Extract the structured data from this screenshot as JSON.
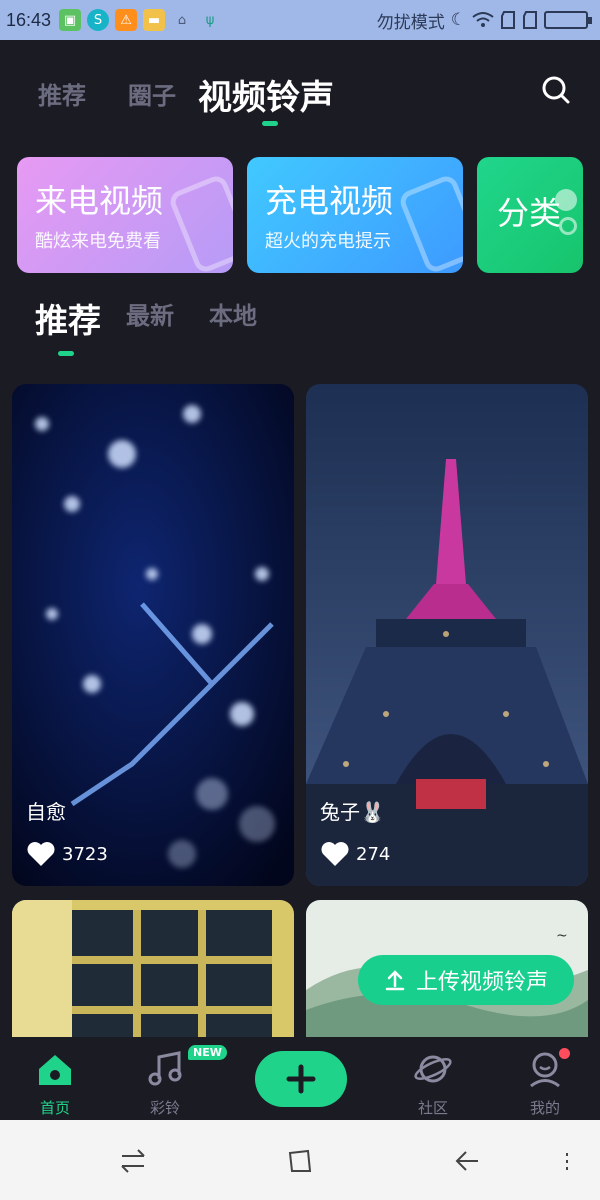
{
  "status_bar": {
    "time": "16:43",
    "dnd_label": "勿扰模式",
    "app_icons": [
      "bag-icon",
      "sogou-icon",
      "warning-icon",
      "folder-icon",
      "broom-icon",
      "usb-icon"
    ]
  },
  "top_tabs": [
    {
      "label": "推荐",
      "active": false
    },
    {
      "label": "圈子",
      "active": false
    },
    {
      "label": "视频铃声",
      "active": true
    }
  ],
  "feature_cards": [
    {
      "title": "来电视频",
      "subtitle": "酷炫来电免费看",
      "color": "#c39af5"
    },
    {
      "title": "充电视频",
      "subtitle": "超火的充电提示",
      "color": "#3fb6ff"
    },
    {
      "title": "分类",
      "subtitle": "",
      "color": "#1fcf7c"
    }
  ],
  "sub_tabs": [
    {
      "label": "推荐",
      "active": true
    },
    {
      "label": "最新",
      "active": false
    },
    {
      "label": "本地",
      "active": false
    }
  ],
  "videos": [
    {
      "title": "自愈",
      "likes": "3723"
    },
    {
      "title": "兔子🐰",
      "likes": "274"
    },
    {
      "title": "",
      "likes": ""
    },
    {
      "title": "",
      "likes": ""
    }
  ],
  "upload_button": {
    "label": "上传视频铃声"
  },
  "bottom_nav": {
    "items": [
      {
        "label": "首页",
        "icon": "home-icon",
        "active": true
      },
      {
        "label": "彩铃",
        "icon": "music-icon",
        "active": false,
        "badge": "NEW"
      },
      {
        "label": "",
        "icon": "plus-icon",
        "active": false
      },
      {
        "label": "社区",
        "icon": "planet-icon",
        "active": false
      },
      {
        "label": "我的",
        "icon": "user-icon",
        "active": false
      }
    ]
  },
  "colors": {
    "background": "#1b1b24",
    "accent": "#1fd48a",
    "status_bar": "#9fb8e8",
    "notification_dot": "#ff4d5d"
  }
}
